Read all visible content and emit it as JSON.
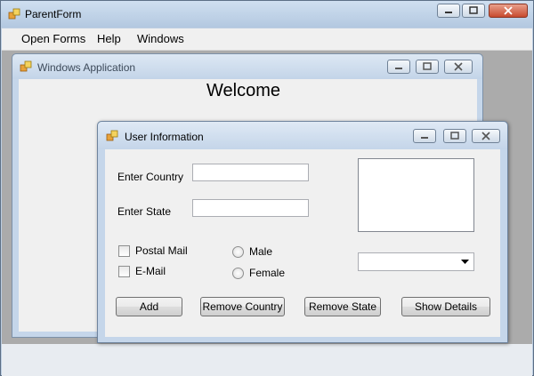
{
  "parent_window": {
    "title": "ParentForm",
    "menu": [
      "Open Forms",
      "Help",
      "Windows"
    ]
  },
  "child_window_1": {
    "title": "Windows Application",
    "welcome": "Welcome"
  },
  "child_window_2": {
    "title": "User Information",
    "country_label": "Enter Country",
    "country_value": "",
    "state_label": "Enter State",
    "state_value": "",
    "checkboxes": [
      {
        "label": "Postal Mail",
        "checked": false
      },
      {
        "label": "E-Mail",
        "checked": false
      }
    ],
    "radios": [
      {
        "label": "Male",
        "checked": false
      },
      {
        "label": "Female",
        "checked": false
      }
    ],
    "combo_value": "",
    "buttons": [
      "Add",
      "Remove Country",
      "Remove State",
      "Show Details"
    ]
  },
  "colors": {
    "title_bar": "#c4d5e9",
    "client_bg": "#f0f0f0",
    "mdi_bg": "#ababab",
    "close_button": "#c74a2e"
  },
  "icons": [
    "app-icon",
    "minimize-icon",
    "maximize-icon",
    "close-icon",
    "dropdown-arrow-icon"
  ]
}
